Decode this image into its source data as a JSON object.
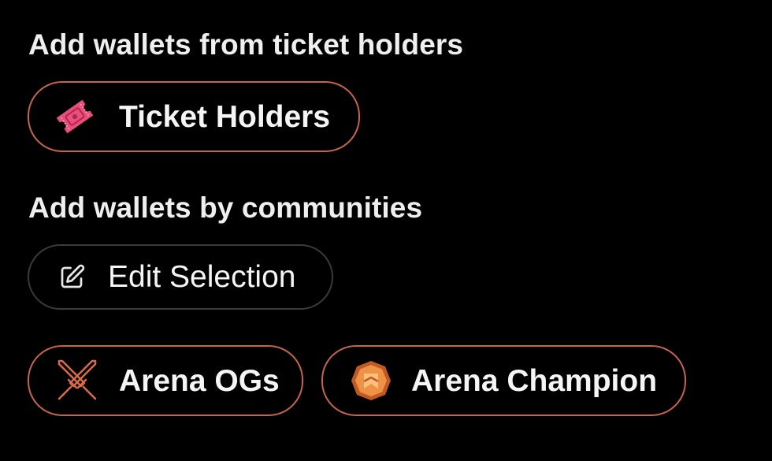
{
  "sections": {
    "ticket_holders": {
      "heading": "Add wallets from ticket holders",
      "button_label": "Ticket Holders",
      "icon": "ticket-icon"
    },
    "communities": {
      "heading": "Add wallets by communities",
      "edit_label": "Edit Selection",
      "edit_icon": "edit-icon",
      "selected": [
        {
          "label": "Arena OGs",
          "icon": "crossed-swords-icon"
        },
        {
          "label": "Arena Champion",
          "icon": "champion-badge-icon"
        }
      ]
    }
  },
  "colors": {
    "background": "#000000",
    "accent_border": "#c8644c",
    "neutral_border": "#3a3a3a",
    "text": "#f5f5f5",
    "ticket": "#e8507a",
    "badge": "#e07a3c"
  }
}
